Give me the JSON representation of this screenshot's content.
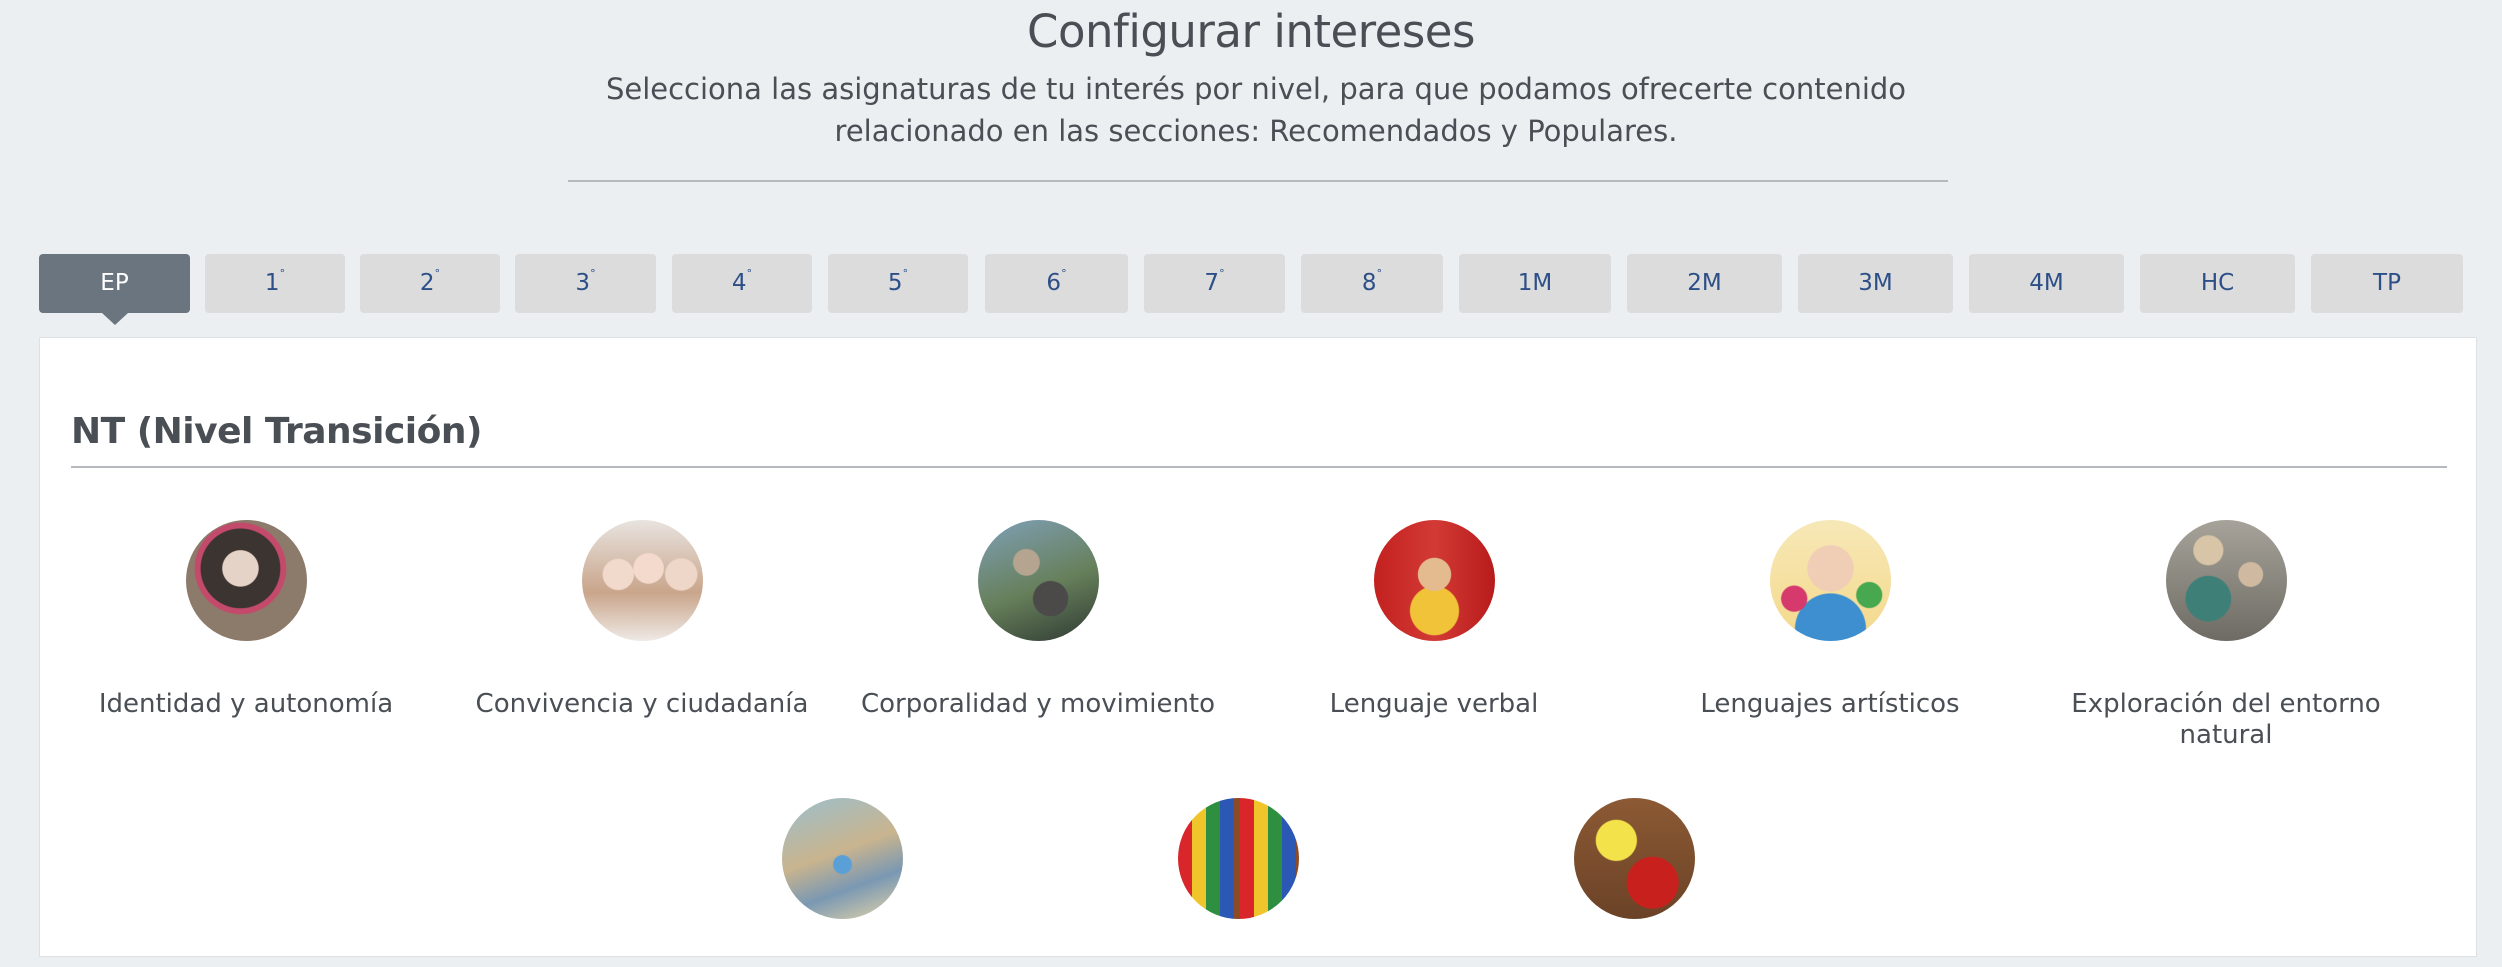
{
  "header": {
    "title": "Configurar intereses",
    "subtitle": "Selecciona las asignaturas de tu interés por nivel, para que podamos ofrecerte contenido relacionado en las secciones: Recomendados y Populares."
  },
  "tabs": [
    {
      "label": "EP",
      "sup": ""
    },
    {
      "label": "1",
      "sup": "°"
    },
    {
      "label": "2",
      "sup": "°"
    },
    {
      "label": "3",
      "sup": "°"
    },
    {
      "label": "4",
      "sup": "°"
    },
    {
      "label": "5",
      "sup": "°"
    },
    {
      "label": "6",
      "sup": "°"
    },
    {
      "label": "7",
      "sup": "°"
    },
    {
      "label": "8",
      "sup": "°"
    },
    {
      "label": "1M",
      "sup": ""
    },
    {
      "label": "2M",
      "sup": ""
    },
    {
      "label": "3M",
      "sup": ""
    },
    {
      "label": "4M",
      "sup": ""
    },
    {
      "label": "HC",
      "sup": ""
    },
    {
      "label": "TP",
      "sup": ""
    }
  ],
  "active_tab": "EP",
  "section": {
    "title": "NT (Nivel Transición)",
    "subjects": [
      {
        "label": "Identidad y autonomía"
      },
      {
        "label": "Convivencia y ciudadanía"
      },
      {
        "label": "Corporalidad y movimiento"
      },
      {
        "label": "Lenguaje verbal"
      },
      {
        "label": "Lenguajes artísticos"
      },
      {
        "label": "Exploración del entorno natural"
      },
      {
        "label": ""
      },
      {
        "label": ""
      },
      {
        "label": ""
      }
    ]
  },
  "colors": {
    "background": "#ebeff2",
    "active_tab": "#6b757f",
    "inactive_tab": "#dcdcdc",
    "tab_text": "#2d4f87",
    "panel": "#ffffff"
  }
}
